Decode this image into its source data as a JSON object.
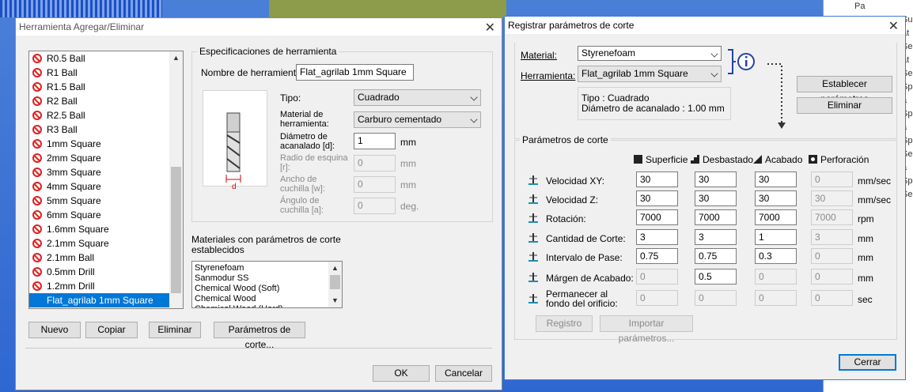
{
  "background": {
    "tree_items": [
      "Pa",
      "Sup",
      "at",
      "Se",
      "at",
      "Se",
      "Sp",
      "a",
      "Sp",
      "a",
      "Sp",
      "Se",
      "a",
      "Sp",
      "Se"
    ]
  },
  "tool_dialog": {
    "title": "Herramienta Agregar/Eliminar",
    "tools": [
      "R0.5 Ball",
      "R1 Ball",
      "R1.5 Ball",
      "R2 Ball",
      "R2.5 Ball",
      "R3 Ball",
      "1mm Square",
      "2mm Square",
      "3mm Square",
      "4mm Square",
      "5mm Square",
      "6mm Square",
      "1.6mm Square",
      "2.1mm Square",
      "2.1mm Ball",
      "0.5mm Drill",
      "1.2mm Drill",
      "Flat_agrilab 1mm Square"
    ],
    "selected_tool": "Flat_agrilab 1mm Square",
    "spec_group_label": "Especificaciones de herramienta",
    "name_label": "Nombre de herramienta:",
    "name_value": "Flat_agrilab 1mm Square",
    "type_label": "Tipo:",
    "type_value": "Cuadrado",
    "material_label": "Material de herramienta:",
    "material_value": "Carburo cementado",
    "diameter_label": "Diámetro de acanalado [d]:",
    "diameter_value": "1",
    "diameter_unit": "mm",
    "radius_label": "Radio de esquina [r]:",
    "radius_value": "0",
    "radius_unit": "mm",
    "width_label": "Ancho de cuchilla [w]:",
    "width_value": "0",
    "width_unit": "mm",
    "angle_label": "Ángulo de cuchilla [a]:",
    "angle_value": "0",
    "angle_unit": "deg.",
    "diagram_label": "d",
    "materials_label": "Materiales con parámetros de corte establecidos",
    "materials": [
      "Styrenefoam",
      "Sanmodur SS",
      "Chemical Wood (Soft)",
      "Chemical Wood",
      "Chemical Wood (Hard)"
    ],
    "btn_new": "Nuevo",
    "btn_copy": "Copiar",
    "btn_delete": "Eliminar",
    "btn_params": "Parámetros de corte...",
    "btn_ok": "OK",
    "btn_cancel": "Cancelar"
  },
  "cut_dialog": {
    "title": "Registrar parámetros de corte",
    "material_label": "Material:",
    "material_value": "Styrenefoam",
    "tool_label": "Herramienta:",
    "tool_value": "Flat_agrilab 1mm Square",
    "info_type": "Tipo : Cuadrado",
    "info_diameter": "Diámetro de acanalado : 1.00 mm",
    "btn_set": "Establecer parámetros",
    "btn_delete": "Eliminar",
    "group_label": "Parámetros de corte",
    "col_surface": "Superficie",
    "col_rough": "Desbastado",
    "col_finish": "Acabado",
    "col_drill": "Perforación",
    "rows": [
      {
        "label": "Velocidad XY:",
        "values": [
          "30",
          "30",
          "30",
          "0"
        ],
        "unit": "mm/sec"
      },
      {
        "label": "Velocidad Z:",
        "values": [
          "30",
          "30",
          "30",
          "30"
        ],
        "unit": "mm/sec"
      },
      {
        "label": "Rotación:",
        "values": [
          "7000",
          "7000",
          "7000",
          "7000"
        ],
        "unit": "rpm"
      },
      {
        "label": "Cantidad de Corte:",
        "values": [
          "3",
          "3",
          "1",
          "3"
        ],
        "unit": "mm"
      },
      {
        "label": "Intervalo de Pase:",
        "values": [
          "0.75",
          "0.75",
          "0.3",
          "0"
        ],
        "unit": "mm"
      },
      {
        "label": "Márgen de Acabado:",
        "values": [
          "0",
          "0.5",
          "0",
          "0"
        ],
        "unit": "mm"
      },
      {
        "label": "Permanecer al fondo del orificio:",
        "values": [
          "0",
          "0",
          "0",
          "0"
        ],
        "unit": "sec"
      }
    ],
    "btn_register": "Registro",
    "btn_import": "Importar parámetros...",
    "btn_close": "Cerrar"
  }
}
